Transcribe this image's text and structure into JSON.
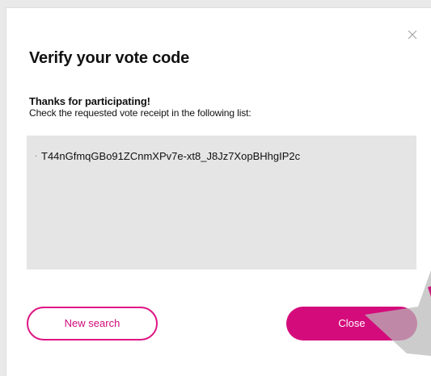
{
  "dialog": {
    "title": "Verify your vote code",
    "message": {
      "heading": "Thanks for participating!",
      "text": "Check the requested vote receipt in the following list:"
    },
    "receipts": [
      "T44nGfmqGBo91ZCnmXPv7e-xt8_J8Jz7XopBHhgIP2c"
    ],
    "buttons": {
      "new_search": "New search",
      "close": "Close"
    }
  },
  "icons": {
    "close": "close-icon",
    "receipt_bullet": "dot-icon"
  },
  "colors": {
    "accent": "#d40b7b",
    "accent_border": "#df1684",
    "result_bg": "#e5e5e5"
  }
}
